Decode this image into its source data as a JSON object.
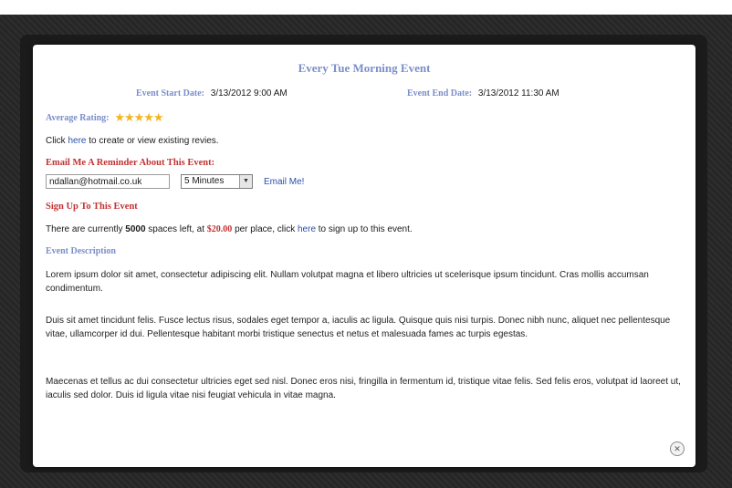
{
  "event": {
    "title": "Every Tue Morning Event",
    "start_label": "Event Start Date:",
    "start_value": "3/13/2012 9:00 AM",
    "end_label": "Event End Date:",
    "end_value": "3/13/2012 11:30 AM",
    "rating_label": "Average Rating:",
    "rating_value": 5,
    "review_prefix": "Click",
    "review_link": "here",
    "review_suffix": "to create or view existing revies."
  },
  "reminder": {
    "heading": "Email Me A Reminder About This Event:",
    "email_value": "ndallan@hotmail.co.uk",
    "time_selected": "5 Minutes",
    "email_button": "Email Me!"
  },
  "signup": {
    "heading": "Sign Up To This Event",
    "text_1": "There are currently",
    "spaces": "5000",
    "text_2": "spaces left, at",
    "price": "$20.00",
    "text_3": "per place, click",
    "link": "here",
    "text_4": "to sign up to this event."
  },
  "description": {
    "heading": "Event Description",
    "paragraphs": [
      " Lorem ipsum dolor sit amet, consectetur adipiscing elit. Nullam volutpat magna et libero ultricies ut scelerisque ipsum tincidunt. Cras mollis accumsan condimentum.",
      "Duis sit amet tincidunt felis. Fusce lectus risus, sodales eget tempor a, iaculis ac ligula. Quisque quis nisi turpis. Donec nibh nunc, aliquet nec pellentesque vitae, ullamcorper id dui. Pellentesque habitant morbi tristique senectus et netus et malesuada fames ac turpis egestas.",
      "Maecenas et tellus ac dui consectetur ultricies eget sed nisl. Donec eros nisi, fringilla in fermentum id, tristique vitae felis. Sed felis eros, volutpat id laoreet ut, iaculis sed dolor. Duis id ligula vitae nisi feugiat vehicula in vitae magna."
    ]
  },
  "close_icon": "close-icon",
  "colors": {
    "heading_blue": "#7b8fc9",
    "heading_red": "#c23232",
    "link": "#2c4fa8",
    "star": "#f2b61d"
  }
}
